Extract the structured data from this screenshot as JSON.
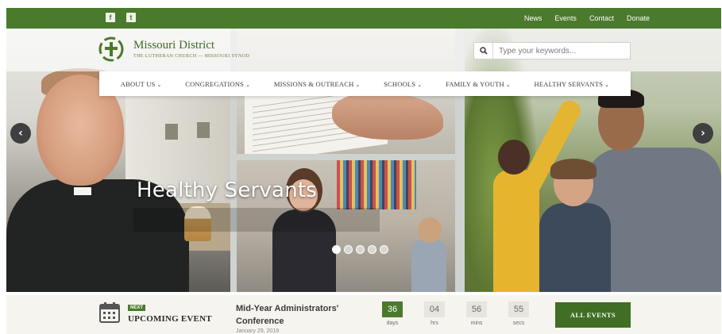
{
  "topbar": {
    "links": [
      "News",
      "Events",
      "Contact",
      "Donate"
    ],
    "social": [
      {
        "icon": "facebook-icon",
        "glyph": "f"
      },
      {
        "icon": "twitter-icon",
        "glyph": "t"
      }
    ]
  },
  "logo": {
    "title": "Missouri District",
    "subtitle": "THE LUTHERAN CHURCH — MISSOURI SYNOD"
  },
  "search": {
    "placeholder": "Type your keywords..."
  },
  "nav": {
    "items": [
      "ABOUT US",
      "CONGREGATIONS",
      "MISSIONS & OUTREACH",
      "SCHOOLS",
      "FAMILY & YOUTH",
      "HEALTHY SERVANTS"
    ]
  },
  "hero": {
    "title": "Healthy Servants",
    "slide_count": 5,
    "active_slide": 1
  },
  "event": {
    "badge": "NEXT",
    "heading": "UPCOMING EVENT",
    "title": "Mid-Year Administrators' Conference",
    "date": "January 29, 2019",
    "countdown": [
      {
        "value": "36",
        "unit": "days"
      },
      {
        "value": "04",
        "unit": "hrs"
      },
      {
        "value": "56",
        "unit": "mins"
      },
      {
        "value": "55",
        "unit": "secs"
      }
    ],
    "all_events_label": "ALL EVENTS"
  },
  "colors": {
    "brand_green": "#4a7a2c",
    "dark_green": "#3f6e24"
  }
}
